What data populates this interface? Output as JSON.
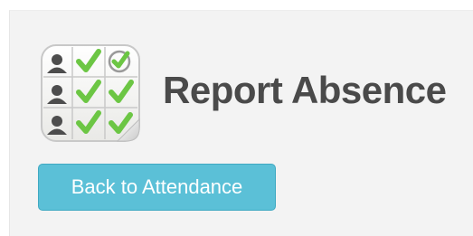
{
  "page": {
    "title": "Report Absence"
  },
  "actions": {
    "back_label": "Back to Attendance"
  },
  "icon": {
    "name": "attendance-sheet-icon",
    "check_color": "#6cc644",
    "person_color": "#4d4d4d",
    "sheet_color": "#f8f8f6"
  },
  "colors": {
    "background": "#f3f3f3",
    "title": "#4a4a4a",
    "button": "#5bc0d7",
    "button_text": "#ffffff"
  }
}
